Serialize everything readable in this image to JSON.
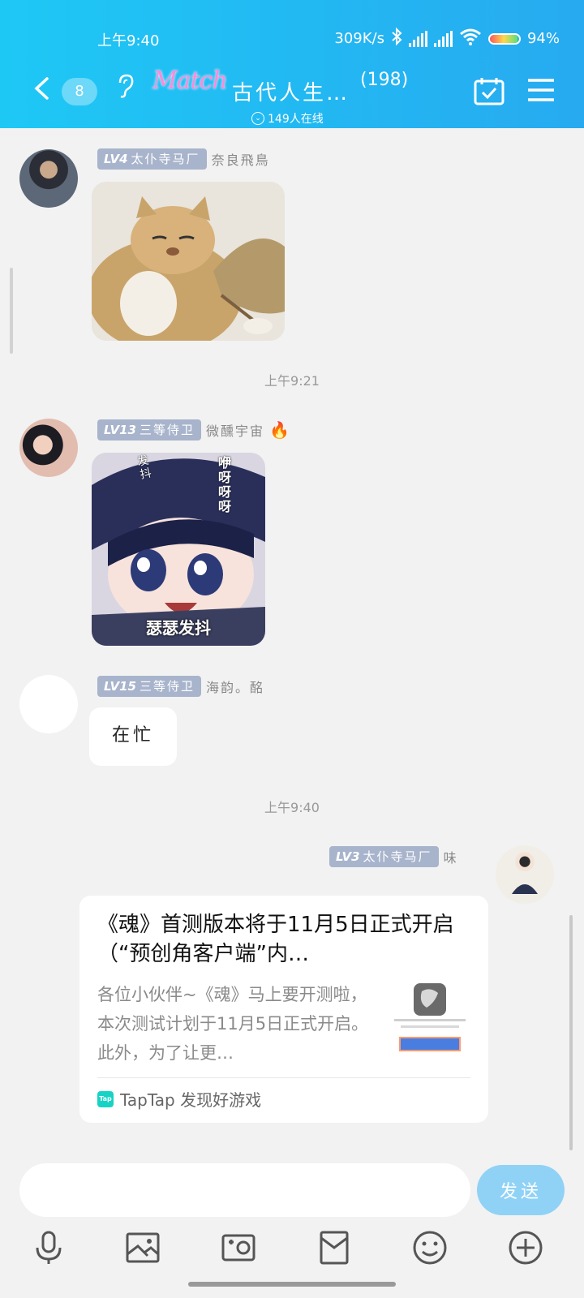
{
  "status": {
    "time": "上午9:40",
    "speed": "309K/s",
    "battery": "94%",
    "battery_level": 0.94
  },
  "header": {
    "unread_count": "8",
    "group_logo_text": "Match",
    "title": "古代人生…",
    "member_count": "(198)",
    "online_text": "149人在线"
  },
  "messages": [
    {
      "level": "LV4",
      "rank": "太仆寺马厂",
      "nickname": "奈良飛鳥"
    },
    {
      "level": "LV13",
      "rank": "三等侍卫",
      "nickname": "微醺宇宙",
      "nickname_emoji": "🔥"
    },
    {
      "level": "LV15",
      "rank": "三等侍卫",
      "nickname": "海韵。酩",
      "text": "在忙"
    },
    {
      "level": "LV3",
      "rank": "太仆寺马厂",
      "nickname": "味"
    }
  ],
  "time_separators": [
    "上午9:21",
    "上午9:40"
  ],
  "sticker_caption": "瑟瑟发抖",
  "sticker_sidetext_left": "发抖",
  "sticker_sidetext_right": "咿呀呀呀",
  "card": {
    "title": "《魂》首测版本将于11月5日正式开启（“预创角客户端”内…",
    "desc": "各位小伙伴~《魂》马上要开测啦，本次测试计划于11月5日正式开启。此外，为了让更…",
    "source": "TapTap 发现好游戏",
    "source_icon_text": "Tap"
  },
  "input": {
    "placeholder": "",
    "value": ""
  },
  "send_label": "发送"
}
